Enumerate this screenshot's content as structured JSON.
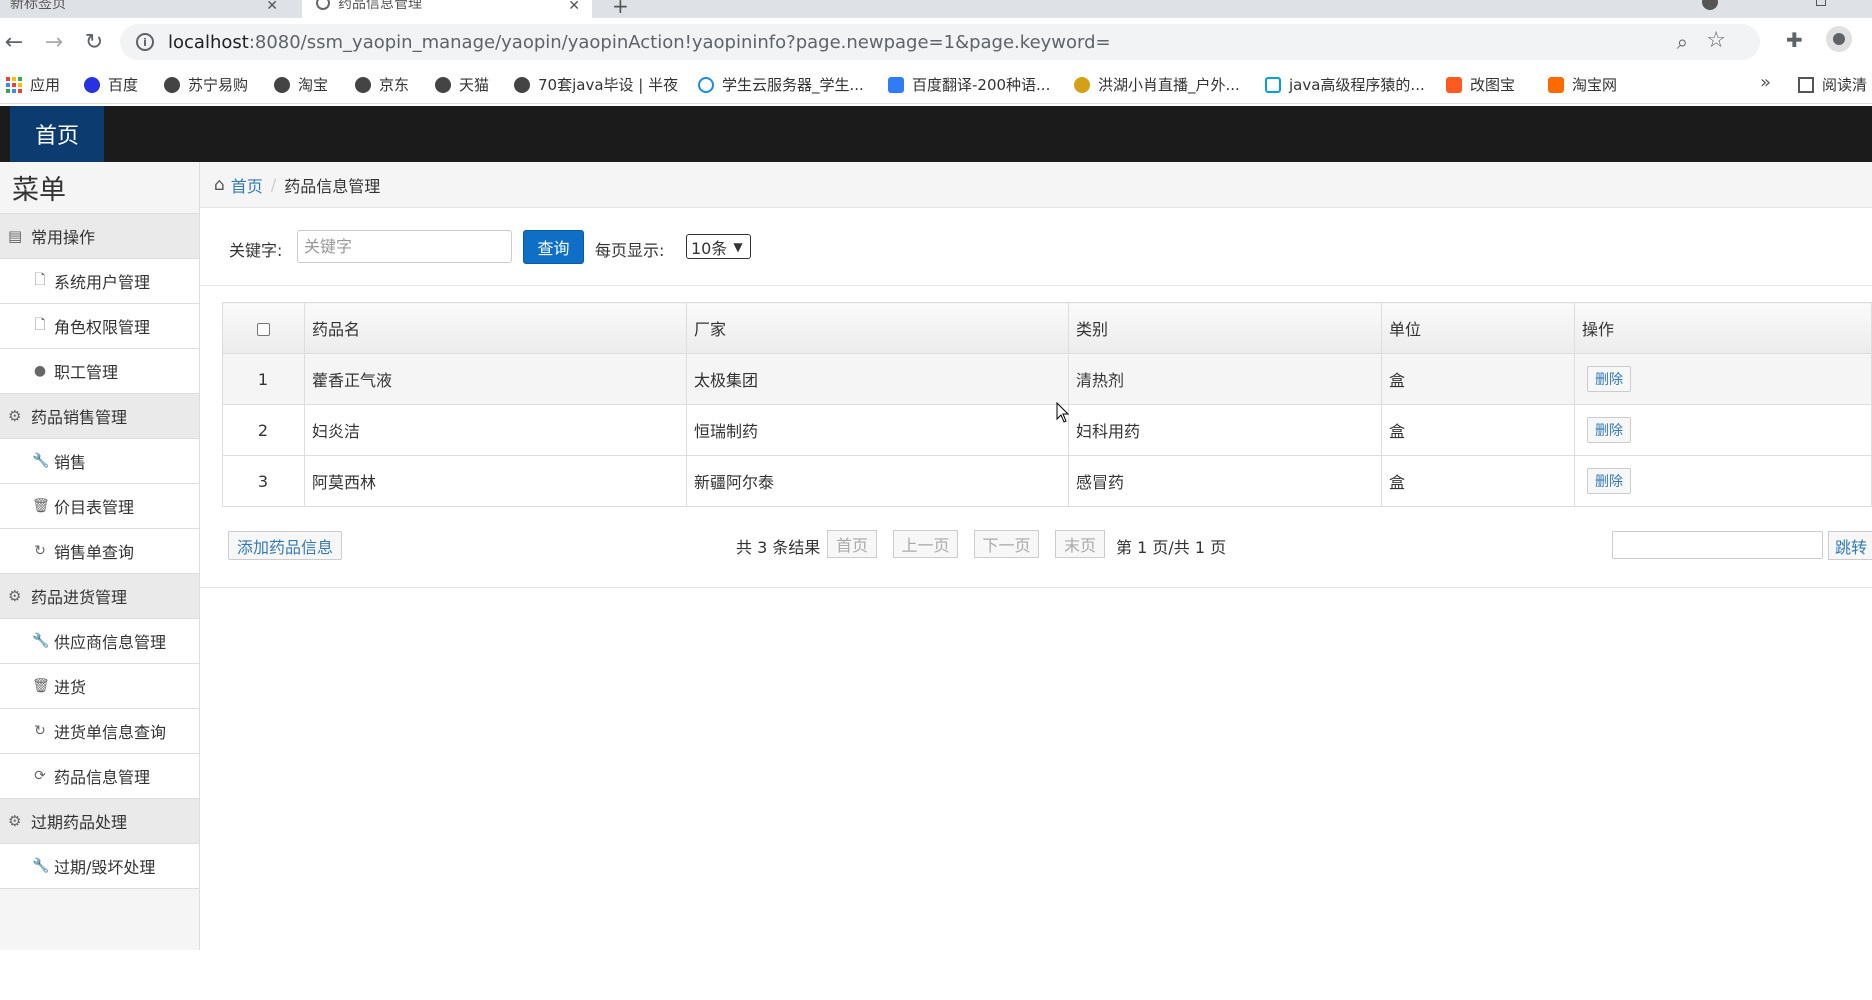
{
  "browser": {
    "tabs": [
      {
        "title": "新标签页"
      },
      {
        "title": "药品信息管理"
      }
    ],
    "newtab": "+",
    "url_host": "localhost",
    "url_path": ":8080/ssm_yaopin_manage/yaopin/yaopinAction!yaopininfo?page.newpage=1&page.keyword=",
    "bookmarks": [
      {
        "label": "应用"
      },
      {
        "label": "百度"
      },
      {
        "label": "苏宁易购"
      },
      {
        "label": "淘宝"
      },
      {
        "label": "京东"
      },
      {
        "label": "天猫"
      },
      {
        "label": "70套java毕设 | 半夜"
      },
      {
        "label": "学生云服务器_学生..."
      },
      {
        "label": "百度翻译-200种语..."
      },
      {
        "label": "洪湖小肖直播_户外..."
      },
      {
        "label": "java高级程序猿的..."
      },
      {
        "label": "改图宝"
      },
      {
        "label": "淘宝网"
      }
    ],
    "bookmarks_more": "»",
    "reading_list": "阅读清"
  },
  "topnav": {
    "home": "首页"
  },
  "sidebar": {
    "title": "菜单",
    "groups": [
      {
        "label": "常用操作",
        "icon": "list-icon",
        "items": [
          {
            "label": "系统用户管理",
            "icon": "file-icon"
          },
          {
            "label": "角色权限管理",
            "icon": "file-icon"
          },
          {
            "label": "职工管理",
            "icon": "comment-icon"
          }
        ]
      },
      {
        "label": "药品销售管理",
        "icon": "gear-icon",
        "items": [
          {
            "label": "销售",
            "icon": "wrench-icon"
          },
          {
            "label": "价目表管理",
            "icon": "trash-icon"
          },
          {
            "label": "销售单查询",
            "icon": "refresh-icon"
          }
        ]
      },
      {
        "label": "药品进货管理",
        "icon": "gear-icon",
        "items": [
          {
            "label": "供应商信息管理",
            "icon": "wrench-icon"
          },
          {
            "label": "进货",
            "icon": "trash-icon"
          },
          {
            "label": "进货单信息查询",
            "icon": "refresh-icon"
          },
          {
            "label": "药品信息管理",
            "icon": "sync-icon"
          }
        ]
      },
      {
        "label": "过期药品处理",
        "icon": "gear-icon",
        "items": [
          {
            "label": "过期/毁坏处理",
            "icon": "wrench-icon"
          }
        ]
      }
    ]
  },
  "breadcrumb": {
    "home": "首页",
    "current": "药品信息管理"
  },
  "search": {
    "keyword_label": "关键字:",
    "placeholder": "关键字",
    "value": "",
    "query_button": "查询",
    "pagesize_label": "每页显示:",
    "pagesize_value": "10条"
  },
  "table": {
    "headers": [
      "药品名",
      "厂家",
      "类别",
      "单位",
      "操作"
    ],
    "delete_label": "删除",
    "rows": [
      {
        "no": "1",
        "name": "藿香正气液",
        "maker": "太极集团",
        "category": "清热剂",
        "unit": "盒"
      },
      {
        "no": "2",
        "name": "妇炎洁",
        "maker": "恒瑞制药",
        "category": "妇科用药",
        "unit": "盒"
      },
      {
        "no": "3",
        "name": "阿莫西林",
        "maker": "新疆阿尔泰",
        "category": "感冒药",
        "unit": "盒"
      }
    ]
  },
  "pager": {
    "add_button": "添加药品信息",
    "total_text": "共 3 条结果",
    "first": "首页",
    "prev": "上一页",
    "next": "下一页",
    "last": "末页",
    "page_info": "第 1 页/共 1 页",
    "jump_button": "跳转"
  }
}
